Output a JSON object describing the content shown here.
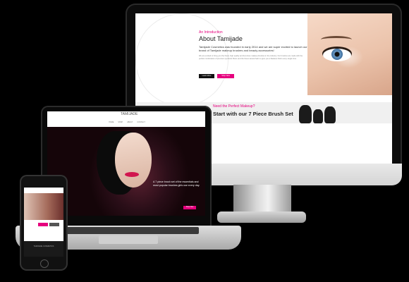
{
  "imac": {
    "intro_label": "An Introduction",
    "title": "About Tamijade",
    "lead": "Tamijade Cosmetics was founded in early 2014 and we are super excited to launch our brand of Tamijade makeup brushes and beauty accessories!",
    "body": "We are excited to bring you the finest, high quality and luxurious makeup brushes in the industry. Our brushes are made with the perfect combination of premium synthetic fibers and the finest natural hairs to give you a flawless finish every single time.",
    "btn_primary": "Learn More",
    "btn_secondary": "Shop Now",
    "promo_question": "Need the Perfect Makeup?",
    "promo_headline": "Start with our 7 Piece Brush Set"
  },
  "laptop": {
    "logo": "TAMIJADE",
    "nav": [
      "HOME",
      "SHOP",
      "ABOUT",
      "CONTACT"
    ],
    "hero_copy": "A 7 piece brush set of the essentials and most popular brushes girls use every day.",
    "cta": "Shop Now"
  },
  "phone": {
    "footer_title": "TAMIJADE COSMETICS"
  },
  "colors": {
    "accent": "#e6007e",
    "dark": "#111111"
  }
}
